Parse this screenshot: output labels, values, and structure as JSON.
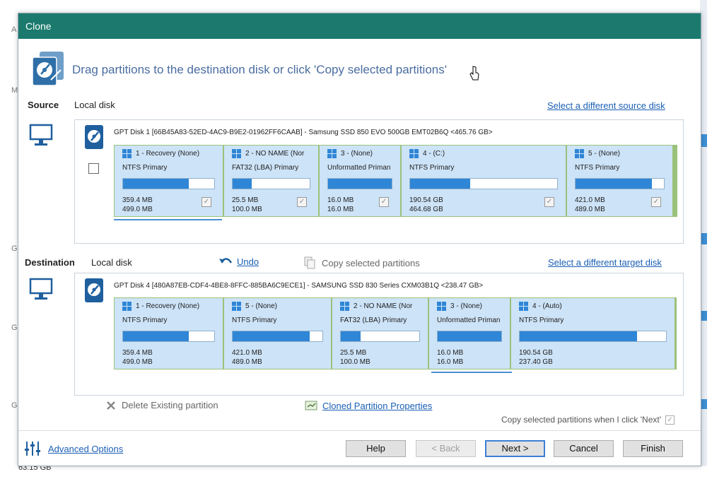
{
  "background": {
    "left_letters": [
      "A",
      "G",
      "G",
      "M",
      "G"
    ],
    "bottom_text": "63.15 GB"
  },
  "dialog": {
    "title": "Clone",
    "instruction": "Drag partitions to the destination disk or click 'Copy selected partitions'"
  },
  "source": {
    "label": "Source",
    "sublabel": "Local disk",
    "select_link": "Select a different source disk",
    "disk_title": "GPT Disk 1 [66B45A83-52ED-4AC9-B9E2-01962FF6CAAB] - Samsung SSD 850 EVO 500GB EMT02B6Q  <465.76 GB>",
    "partitions": [
      {
        "name": "1 - Recovery (None)",
        "fs": "NTFS Primary",
        "used": "359.4 MB",
        "total": "499.0 MB",
        "fill": 0.72
      },
      {
        "name": "2 - NO NAME (Nor",
        "fs": "FAT32 (LBA) Primary",
        "used": "25.5 MB",
        "total": "100.0 MB",
        "fill": 0.25
      },
      {
        "name": "3 - (None)",
        "fs": "Unformatted Priman",
        "used": "16.0 MB",
        "total": "16.0 MB",
        "fill": 1.0
      },
      {
        "name": "4 - (C:)",
        "fs": "NTFS Primary",
        "used": "190.54 GB",
        "total": "464.68 GB",
        "fill": 0.41
      },
      {
        "name": "5 - (None)",
        "fs": "NTFS Primary",
        "used": "421.0 MB",
        "total": "489.0 MB",
        "fill": 0.86
      }
    ]
  },
  "destination": {
    "label": "Destination",
    "sublabel": "Local disk",
    "undo": "Undo",
    "copy_selected": "Copy selected partitions",
    "select_link": "Select a different target disk",
    "disk_title": "GPT Disk 4 [480A87EB-CDF4-4BE8-8FFC-885BA6C9ECE1] - SAMSUNG SSD 830 Series CXM03B1Q  <238.47 GB>",
    "partitions": [
      {
        "name": "1 - Recovery (None)",
        "fs": "NTFS Primary",
        "used": "359.4 MB",
        "total": "499.0 MB",
        "fill": 0.72
      },
      {
        "name": "5 - (None)",
        "fs": "NTFS Primary",
        "used": "421.0 MB",
        "total": "489.0 MB",
        "fill": 0.86
      },
      {
        "name": "2 - NO NAME (Nor",
        "fs": "FAT32 (LBA) Primary",
        "used": "25.5 MB",
        "total": "100.0 MB",
        "fill": 0.25
      },
      {
        "name": "3 - (None)",
        "fs": "Unformatted Priman",
        "used": "16.0 MB",
        "total": "16.0 MB",
        "fill": 1.0
      },
      {
        "name": "4 - (Auto)",
        "fs": "NTFS Primary",
        "used": "190.54 GB",
        "total": "237.40 GB",
        "fill": 0.8
      }
    ]
  },
  "actions": {
    "delete_existing": "Delete Existing partition",
    "cloned_properties": "Cloned Partition Properties",
    "copy_note": "Copy selected partitions when I click 'Next'"
  },
  "footer": {
    "advanced_options": "Advanced Options",
    "help": "Help",
    "back": "< Back",
    "next": "Next >",
    "cancel": "Cancel",
    "finish": "Finish"
  },
  "colors": {
    "titlebar": "#1b7a6d",
    "partition_bg": "#cde3f7",
    "partition_border": "#9ac27a",
    "bar_fill": "#2f86d6",
    "link": "#1a5fb4"
  }
}
